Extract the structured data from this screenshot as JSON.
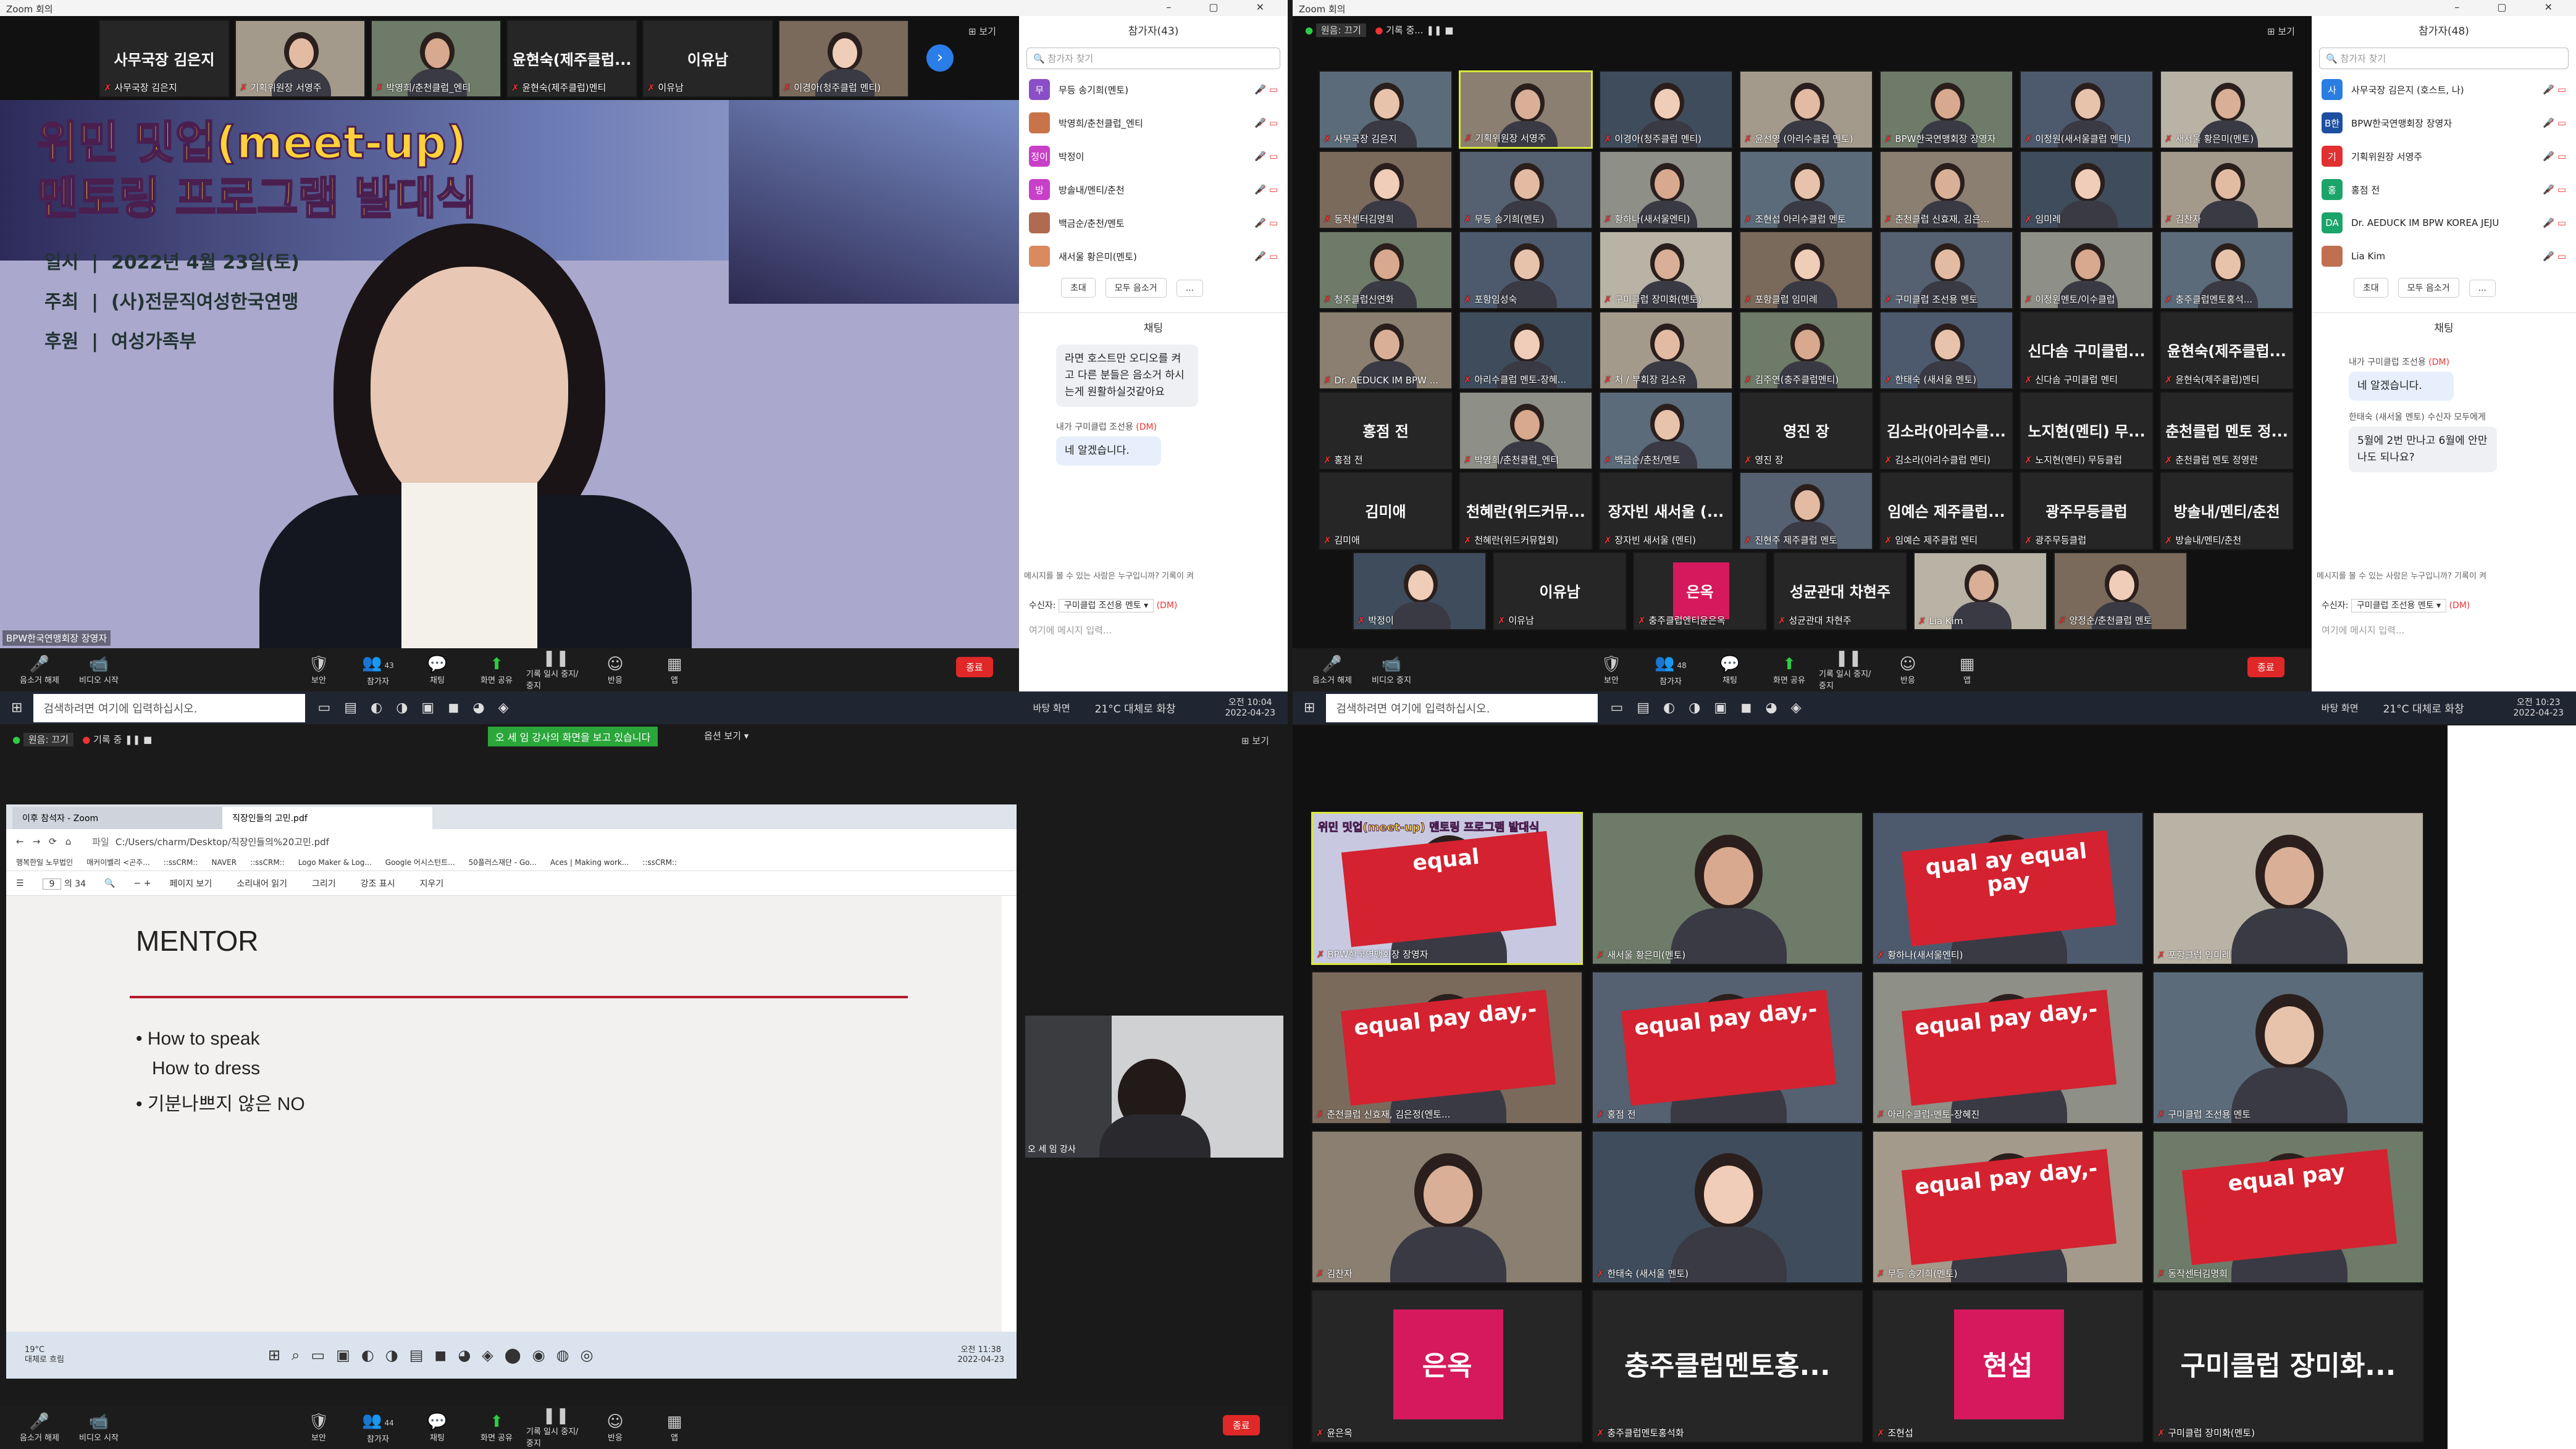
{
  "q1": {
    "title": "Zoom 회의",
    "view_label": "보기",
    "strip": [
      {
        "big": "사무국장 김은지",
        "nm": "사무국장 김은지"
      },
      {
        "big": "",
        "nm": "기획위원장 서영주"
      },
      {
        "big": "",
        "nm": "박영희/춘천클럽_엔티"
      },
      {
        "big": "윤현숙(제주클럽...",
        "nm": "윤현숙(제주클럽)멘티"
      },
      {
        "big": "이유남",
        "nm": "이유남"
      },
      {
        "big": "",
        "nm": "이경아(청주클럽 멘티)"
      }
    ],
    "slide": {
      "title1": "위민 밋업(meet-up)",
      "title2": "멘토링 프로그램 발대식",
      "r1k": "일시",
      "r1v": "2022년 4월 23일(토)",
      "r2k": "주최",
      "r2v": "(사)전문직여성한국연맹",
      "r3k": "후원",
      "r3v": "여성가족부"
    },
    "speaker": "BPW한국연맹회장 장영자",
    "participants_title": "참가자(43)",
    "search_placeholder": "참가자 찾기",
    "participants": [
      {
        "av": "무",
        "color": "#8a4fc6",
        "name": "무등 송기희(멘토)"
      },
      {
        "av": "",
        "color": "#c9734a",
        "name": "박영희/춘천클럽_엔티"
      },
      {
        "av": "정이",
        "color": "#c83fc8",
        "name": "박정이"
      },
      {
        "av": "방",
        "color": "#c83fc8",
        "name": "방솔내/멘티/춘천"
      },
      {
        "av": "",
        "color": "#b06a50",
        "name": "백금순/춘천/멘토"
      },
      {
        "av": "",
        "color": "#d98a5e",
        "name": "새서울 황은미(멘토)"
      }
    ],
    "invite": "초대",
    "muteall": "모두 음소거",
    "more": "...",
    "chat_title": "채팅",
    "chat": [
      {
        "text": "라면 호스트만 오디오를 켜고 다른 분들은 음소거 하시는게 원활하실것같아요"
      },
      {
        "from": "내가 구미클럽 조선용",
        "dm": "(DM)",
        "text": "네 알겠습니다."
      }
    ],
    "chat_notice": "메시지를 볼 수 있는 사람은 누구입니까? 기록이 켜",
    "recv_label": "수신자:",
    "recv_value": "구미클럽 조선용 멘토 ▾",
    "recv_dm": "(DM)",
    "chat_input": "여기에 메시지 입력...",
    "toolbar": [
      "음소거 해제",
      "비디오 시작",
      "보안",
      "참가자",
      "채팅",
      "화면 공유",
      "기록 일시 중지/중지",
      "반응",
      "앱"
    ],
    "participant_count": "43",
    "end": "종료",
    "taskbar": {
      "search": "검색하려면 여기에 입력하십시오.",
      "bg": "바탕 화면",
      "weather": "21°C 대체로 화창",
      "time": "오전 10:04",
      "date": "2022-04-23"
    }
  },
  "q2": {
    "title": "Zoom 회의",
    "view_label": "보기",
    "topbar": [
      "원음: 끄기",
      "기록 중..."
    ],
    "gallery": [
      {
        "nm": "사무국장 김은지"
      },
      {
        "nm": "기획위원장 서영주"
      },
      {
        "nm": "이경아(청주클럽 멘티)"
      },
      {
        "nm": "윤선영 (아리수클럽 멘토)"
      },
      {
        "nm": "BPW한국연맹회장 장영자"
      },
      {
        "nm": "이정원(새서울클럽 멘티)"
      },
      {
        "nm": "새서울 황은미(멘토)"
      },
      {
        "nm": "동작센터김명희"
      },
      {
        "nm": "무등 송기희(멘토)"
      },
      {
        "nm": "황하나(새서울엔티)"
      },
      {
        "nm": "조현섭 아리수클럽 멘토"
      },
      {
        "nm": "춘천클럽 신효재, 김은..."
      },
      {
        "nm": "임미례"
      },
      {
        "nm": "김찬자"
      },
      {
        "nm": "청주클럽신연화"
      },
      {
        "nm": "포항임성숙"
      },
      {
        "nm": "구미클럽 장미화(멘토)"
      },
      {
        "nm": "포항클럽 임미례"
      },
      {
        "nm": "구미클럽 조선용 멘토"
      },
      {
        "nm": "이정원멘토/이수클럽"
      },
      {
        "nm": "충주클럽멘토홍석..."
      },
      {
        "nm": "Dr. AEDUCK IM BPW ..."
      },
      {
        "nm": "아리수클럽 멘토-장혜..."
      },
      {
        "nm": "처 / 부회장 김소유"
      },
      {
        "nm": "김주연(충주클럽멘티)"
      },
      {
        "nm": "한태숙 (새서울 멘토)"
      },
      {
        "big": "신다솜 구미클럽...",
        "nm": "신다솜 구미클럽 멘티"
      },
      {
        "big": "윤현숙(제주클럽...",
        "nm": "윤현숙(제주클럽)멘티"
      },
      {
        "big": "홍점 전",
        "nm": "홍점 전"
      },
      {
        "nm": "박영희/춘천클럽_엔티"
      },
      {
        "nm": "백금순/춘천/멘토"
      },
      {
        "big": "영진 장",
        "nm": "영진 장"
      },
      {
        "big": "김소라(아리수클...",
        "nm": "김소라(아리수클럽 멘티)"
      },
      {
        "big": "노지현(멘티) 무...",
        "nm": "노지현(멘티) 무등클럽"
      },
      {
        "big": "춘천클럽 멘토 정...",
        "nm": "춘천클럽 멘토 정영란"
      },
      {
        "big": "김미애",
        "nm": "김미애"
      },
      {
        "big": "천혜란(위드커뮤...",
        "nm": "천혜란(위드커뮤협회)"
      },
      {
        "big": "장자빈 새서울 (...",
        "nm": "장자빈 새서울 (멘티)"
      },
      {
        "nm": "진현주 제주클럽 멘토"
      },
      {
        "big": "임예슨 제주클럽...",
        "nm": "임예슨 제주클럽 멘티"
      },
      {
        "big": "광주무등클럽",
        "nm": "광주무등클럽"
      },
      {
        "big": "방솔내/멘티/춘천",
        "nm": "방솔내/멘티/춘천"
      },
      {
        "nm": "박정이"
      },
      {
        "big": "이유남",
        "nm": "이유남"
      },
      {
        "big": "은옥",
        "nm": "충주클럽엔티윤은옥",
        "pink": true
      },
      {
        "big": "성균관대 차현주",
        "nm": "성균관대 차현주"
      },
      {
        "nm": "Lia Kim"
      },
      {
        "nm": "양정순/춘천클럽 멘토"
      }
    ],
    "participants_title": "참가자(48)",
    "search_placeholder": "참가자 찾기",
    "participants": [
      {
        "av": "사",
        "color": "#2a7de1",
        "name": "사무국장 김은지 (호스트, 나)"
      },
      {
        "av": "B한",
        "color": "#1d4fa0",
        "name": "BPW한국연맹회장 장영자"
      },
      {
        "av": "기",
        "color": "#e03030",
        "name": "기획위원장 서영주"
      },
      {
        "av": "홍",
        "color": "#1aa46a",
        "name": "홍점 전"
      },
      {
        "av": "DA",
        "color": "#1aa46a",
        "name": "Dr. AEDUCK IM BPW KOREA JEJU"
      },
      {
        "av": "",
        "color": "#c07050",
        "name": "Lia Kim"
      }
    ],
    "invite": "초대",
    "muteall": "모두 음소거",
    "more": "...",
    "chat_title": "채팅",
    "chat": [
      {
        "from": "내가 구미클럽 조선용",
        "dm": "(DM)",
        "text": "네 알겠습니다."
      },
      {
        "from": "한태숙 (새서울 멘토) 수신자 모두에게",
        "text": "5월에 2번 만나고 6월에 안만나도 되나요?"
      }
    ],
    "chat_notice": "메시지를 볼 수 있는 사람은 누구입니까? 기록이 켜",
    "recv_label": "수신자:",
    "recv_value": "구미클럽 조선용 멘토 ▾",
    "recv_dm": "(DM)",
    "chat_input": "여기에 메시지 입력...",
    "toolbar": [
      "음소거 해제",
      "비디오 중지",
      "보안",
      "참가자",
      "채팅",
      "화면 공유",
      "기록 일시 중지/중지",
      "반응",
      "앱"
    ],
    "participant_count": "48",
    "end": "종료",
    "taskbar": {
      "search": "검색하려면 여기에 입력하십시오.",
      "bg": "바탕 화면",
      "weather": "21°C 대체로 화창",
      "time": "오전 10:23",
      "date": "2022-04-23"
    }
  },
  "q3": {
    "topbar": [
      "원음: 끄기",
      "기록 중"
    ],
    "share_notice": "오 세 임 강사의 화면을 보고 있습니다",
    "view_option": "옵션 보기 ▾",
    "view_label": "보기",
    "browser": {
      "tabs": [
        "이후 참석자 - Zoom",
        "직장인들의 고민.pdf"
      ],
      "url_prefix": "파일",
      "url": "C:/Users/charm/Desktop/직장인들의%20고민.pdf",
      "bookmarks": [
        "행복한일 노무법인",
        "매커이벨리 <곤주...",
        "::ssCRM::",
        "NAVER",
        "::ssCRM::",
        "Logo Maker & Log...",
        "Google 어시스턴트...",
        "50플러스재단 - Go...",
        "Aces | Making work...",
        "::ssCRM::"
      ],
      "page": "9",
      "page_total": "의 34",
      "pdf_tools": [
        "페이지 보기",
        "소리내어 읽기",
        "그리기",
        "강조 표시",
        "지우기"
      ]
    },
    "slide": {
      "title": "MENTOR",
      "b1": "How to speak",
      "b1b": "How to dress",
      "b2": "기분나쁘지 않은 NO"
    },
    "inner_taskbar": {
      "weather": "19°C",
      "weather2": "대체로 흐림",
      "time": "오전 11:38",
      "date": "2022-04-23"
    },
    "presenter": "오 세 임 강사",
    "toolbar": [
      "음소거 해제",
      "비디오 시작",
      "보안",
      "참가자",
      "채팅",
      "화면 공유",
      "기록 일시 중지/중지",
      "반응",
      "앱"
    ],
    "participant_count": "44",
    "end": "종료"
  },
  "q4": {
    "gallery": [
      {
        "nm": "BPW한국연맹회장 장영자",
        "slide": "위민 밋업(meet-up) 멘토링 프로그램 발대식",
        "sign": "equal"
      },
      {
        "nm": "새서울 황은미(멘토)"
      },
      {
        "nm": "황하나(새서울엔티)",
        "sign": "qual ay   equal pay"
      },
      {
        "nm": "포항클럽 임미례"
      },
      {
        "nm": "춘천클럽 신효재, 김은정(엔토...",
        "sign": "equal pay day,-"
      },
      {
        "nm": "홍점 전",
        "sign": "equal pay day,-"
      },
      {
        "nm": "아리수클럽-멘토-장혜진",
        "sign": "equal pay day,-"
      },
      {
        "nm": "구미클럽 조선용 멘토"
      },
      {
        "nm": "김찬자"
      },
      {
        "nm": "한태숙 (새서울 멘토)"
      },
      {
        "nm": "무등 송기희(멘토)",
        "sign": "equal pay day,-"
      },
      {
        "nm": "동작센터김명희",
        "sign": "equal pay"
      },
      {
        "big": "은옥",
        "nm": "윤은옥",
        "pink": true
      },
      {
        "big": "충주클럽멘토홍...",
        "nm": "충주클럽멘토홍석화"
      },
      {
        "big": "현섭",
        "nm": "조현섭",
        "pink": true
      },
      {
        "big": "구미클럽 장미화...",
        "nm": "구미클럽 장미화(멘토)"
      }
    ]
  }
}
